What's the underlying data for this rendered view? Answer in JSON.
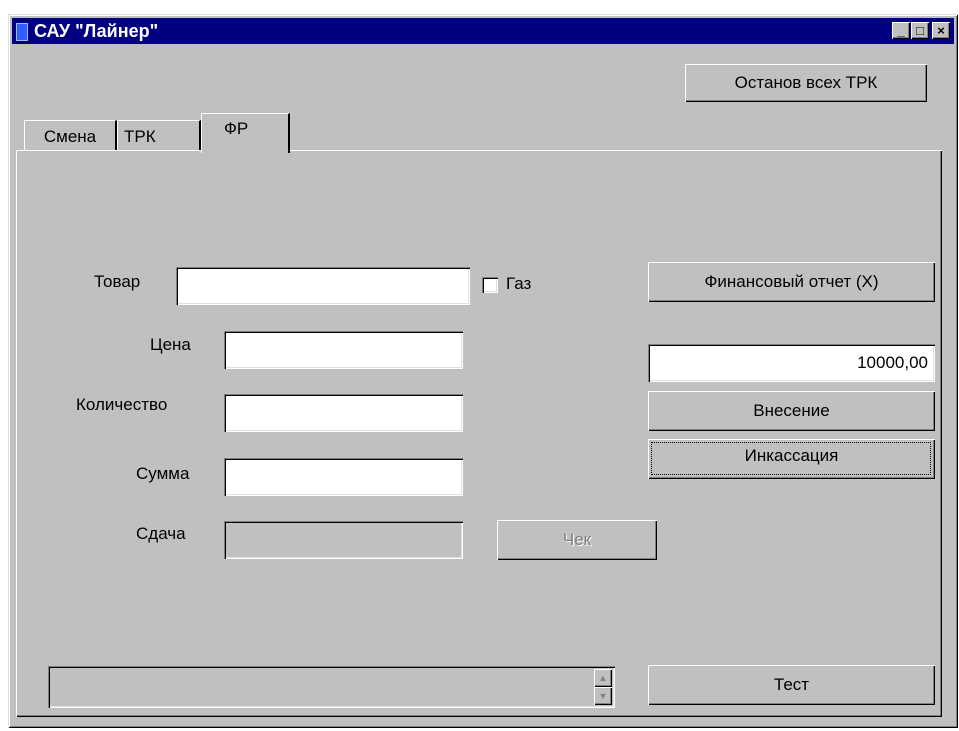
{
  "window": {
    "title": "САУ \"Лайнер\"",
    "controls": {
      "minimize": "_",
      "maximize": "□",
      "close": "×"
    }
  },
  "toolbar": {
    "stop_all_label": "Останов всех ТРК"
  },
  "tabs": [
    {
      "label": "Смена",
      "selected": false
    },
    {
      "label": "ТРК",
      "selected": false
    },
    {
      "label": "ФР",
      "selected": true
    }
  ],
  "form": {
    "product_label": "Товар",
    "product_value": "",
    "gas_label": "Газ",
    "gas_checked": false,
    "price_label": "Цена",
    "price_value": "",
    "quantity_label": "Количество",
    "quantity_value": "",
    "sum_label": "Сумма",
    "sum_value": "",
    "change_label": "Сдача",
    "change_value": "",
    "receipt_label": "Чек"
  },
  "right_panel": {
    "financial_report_label": "Финансовый отчет (X)",
    "amount_value": "10000,00",
    "deposit_label": "Внесение",
    "collection_label": "Инкассация",
    "test_label": "Тест"
  },
  "status": {
    "text": ""
  }
}
